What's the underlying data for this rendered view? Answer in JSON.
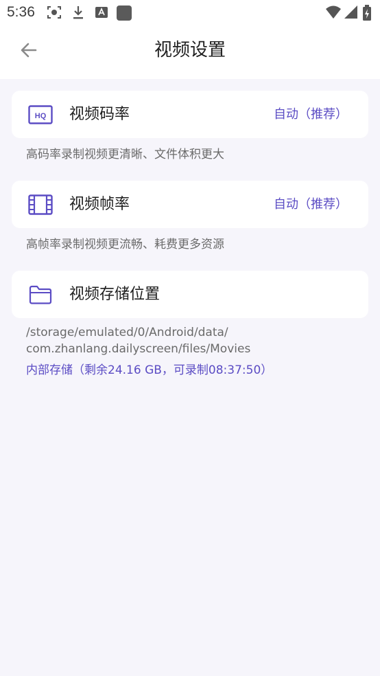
{
  "status_bar": {
    "time": "5:36",
    "icons": [
      "screen-record-icon",
      "download-icon",
      "a-text-icon",
      "square-app-icon",
      "wifi-icon",
      "signal-icon",
      "battery-icon"
    ]
  },
  "app_bar": {
    "title": "视频设置",
    "back_icon": "back-arrow-icon"
  },
  "settings": [
    {
      "icon": "hq-icon",
      "label": "视频码率",
      "value": "自动（推荐）",
      "description": "高码率录制视频更清晰、文件体积更大"
    },
    {
      "icon": "film-icon",
      "label": "视频帧率",
      "value": "自动（推荐）",
      "description": "高帧率录制视频更流畅、耗费更多资源"
    },
    {
      "icon": "folder-icon",
      "label": "视频存储位置",
      "path_line1": "/storage/emulated/0/Android/data/",
      "path_line2": "com.zhanlang.dailyscreen/files/Movies",
      "storage_info": "内部存储（剩余24.16 GB，可录制08:37:50）"
    }
  ],
  "colors": {
    "accent": "#5b4cc4",
    "background": "#f6f5fb",
    "card": "#ffffff",
    "secondary_text": "#6a6a6a"
  }
}
